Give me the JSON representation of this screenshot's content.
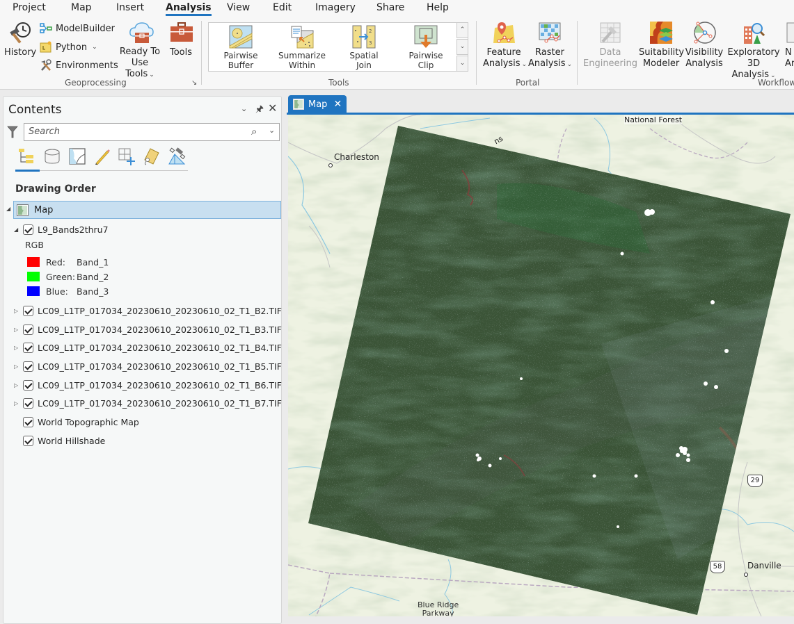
{
  "menu": {
    "tabs": [
      {
        "label": "Project"
      },
      {
        "label": "Map"
      },
      {
        "label": "Insert"
      },
      {
        "label": "Analysis",
        "active": true
      },
      {
        "label": "View"
      },
      {
        "label": "Edit"
      },
      {
        "label": "Imagery"
      },
      {
        "label": "Share"
      },
      {
        "label": "Help"
      }
    ]
  },
  "ribbon": {
    "geoprocessing": {
      "group_label": "Geoprocessing",
      "history": "History",
      "modelbuilder": "ModelBuilder",
      "python": "Python",
      "environments": "Environments",
      "ready_to_use_line1": "Ready To",
      "ready_to_use_line2": "Use Tools",
      "tools": "Tools"
    },
    "tools": {
      "group_label": "Tools",
      "items": [
        {
          "line1": "Pairwise",
          "line2": "Buffer",
          "icon": "pairwise-buffer-icon"
        },
        {
          "line1": "Summarize",
          "line2": "Within",
          "icon": "summarize-within-icon"
        },
        {
          "line1": "Spatial",
          "line2": "Join",
          "icon": "spatial-join-icon"
        },
        {
          "line1": "Pairwise",
          "line2": "Clip",
          "icon": "pairwise-clip-icon"
        }
      ]
    },
    "portal": {
      "group_label": "Portal",
      "feature_line1": "Feature",
      "feature_line2": "Analysis",
      "raster_line1": "Raster",
      "raster_line2": "Analysis"
    },
    "workflows": {
      "group_label": "Workflow",
      "data_eng_line1": "Data",
      "data_eng_line2": "Engineering",
      "suitability_line1": "Suitability",
      "suitability_line2": "Modeler",
      "visibility_line1": "Visibility",
      "visibility_line2": "Analysis",
      "exploratory_line1": "Exploratory",
      "exploratory_line2": "3D Analysis",
      "cut_line1": "N",
      "cut_line2": "Ar"
    }
  },
  "contents": {
    "title": "Contents",
    "search_placeholder": "Search",
    "section_title": "Drawing Order",
    "map_label": "Map",
    "composite_layer": "L9_Bands2thru7",
    "renderer": "RGB",
    "legend": [
      {
        "label": "Red:",
        "band": "Band_1",
        "color": "#ff0000"
      },
      {
        "label": "Green:",
        "band": "Band_2",
        "color": "#00ff00"
      },
      {
        "label": "Blue:",
        "band": "Band_3",
        "color": "#0000ff"
      }
    ],
    "band_layers": [
      {
        "name": "LC09_L1TP_017034_20230610_20230610_02_T1_B2.TIF",
        "checked": true
      },
      {
        "name": "LC09_L1TP_017034_20230610_20230610_02_T1_B3.TIF",
        "checked": true
      },
      {
        "name": "LC09_L1TP_017034_20230610_20230610_02_T1_B4.TIF",
        "checked": true
      },
      {
        "name": "LC09_L1TP_017034_20230610_20230610_02_T1_B5.TIF",
        "checked": true
      },
      {
        "name": "LC09_L1TP_017034_20230610_20230610_02_T1_B6.TIF",
        "checked": true
      },
      {
        "name": "LC09_L1TP_017034_20230610_20230610_02_T1_B7.TIF",
        "checked": true
      }
    ],
    "basemaps": [
      {
        "name": "World Topographic Map",
        "checked": true
      },
      {
        "name": "World Hillshade",
        "checked": true
      }
    ]
  },
  "map_view": {
    "tab_label": "Map",
    "labels": {
      "charleston": "Charleston",
      "national_forest": "National Forest",
      "danville": "Danville",
      "blue_ridge_1": "Blue Ridge",
      "blue_ridge_2": "Parkway",
      "partial_ns": "ns"
    },
    "shields": {
      "us29": "29",
      "us58": "58"
    }
  },
  "colors": {
    "accent": "#1f74c0",
    "selection": "#c8dff0",
    "imagery_green": "#3c5a38"
  }
}
